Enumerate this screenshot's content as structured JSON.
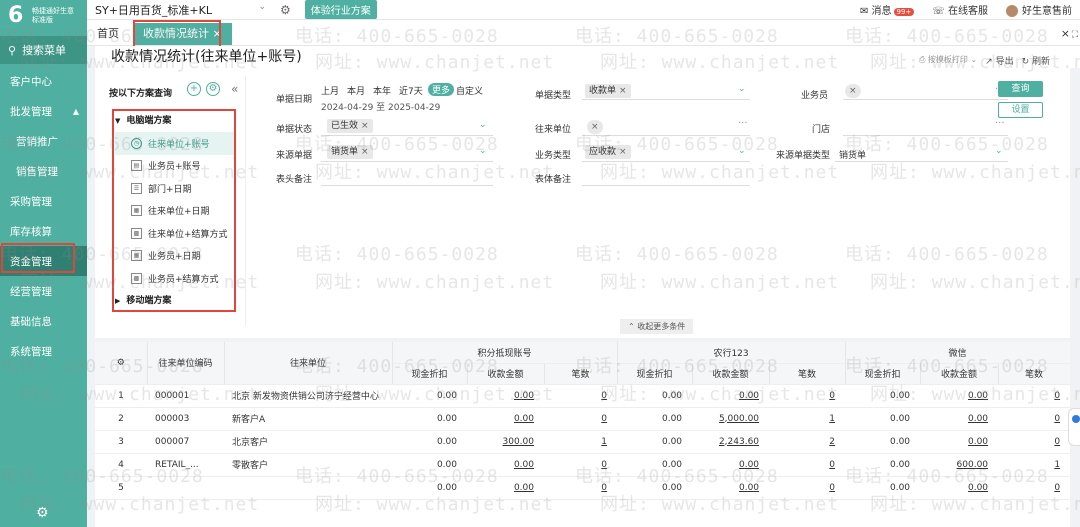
{
  "brand": {
    "logo_mark": "6",
    "logo_text_line1": "畅捷通好生意",
    "logo_text_line2": "标准版"
  },
  "sidebar": {
    "search_label": "搜索菜单",
    "items": [
      {
        "label": "客户中心"
      },
      {
        "label": "批发管理",
        "caret": "▲"
      },
      {
        "label": "营销推广"
      },
      {
        "label": "销售管理"
      },
      {
        "label": "采购管理"
      },
      {
        "label": "库存核算"
      },
      {
        "label": "资金管理"
      },
      {
        "label": "经营管理"
      },
      {
        "label": "基础信息"
      },
      {
        "label": "系统管理"
      }
    ]
  },
  "topbar": {
    "company": "SY+日用百货_标准+KL",
    "industry_button": "体验行业方案",
    "messages": "消息",
    "messages_badge": "99+",
    "support": "在线客服",
    "user": "好生意售前"
  },
  "tabs": {
    "home": "首页",
    "active": "收款情况统计",
    "active_close": "×",
    "close_all": "×"
  },
  "page": {
    "title": "收款情况统计(往来单位+账号)",
    "print": "按模板打印",
    "export": "导出",
    "refresh": "刷新"
  },
  "scheme": {
    "title": "按以下方案查询",
    "pc_group": "电脑端方案",
    "mobile_group": "移动端方案",
    "items": [
      {
        "label": "往来单位+账号",
        "selected": true
      },
      {
        "label": "业务员+账号"
      },
      {
        "label": "部门+日期"
      },
      {
        "label": "往来单位+日期"
      },
      {
        "label": "往来单位+结算方式"
      },
      {
        "label": "业务员+日期"
      },
      {
        "label": "业务员+结算方式"
      }
    ]
  },
  "filters": {
    "doc_date": "单据日期",
    "date_opts": [
      "上月",
      "本月",
      "本年",
      "近7天",
      "更多",
      "自定义"
    ],
    "date_range": "2024-04-29 至 2025-04-29",
    "doc_status": "单据状态",
    "doc_status_tag": "已生效",
    "source_doc": "来源单据",
    "source_doc_tag": "销货单",
    "header_note": "表头备注",
    "doc_type": "单据类型",
    "doc_type_tag": "收款单",
    "partner": "往来单位",
    "biz_type": "业务类型",
    "biz_type_tag": "应收款",
    "body_note": "表体备注",
    "salesman": "业务员",
    "store": "门店",
    "source_doc_type": "来源单据类型",
    "source_doc_type_value": "销货单",
    "query_button": "查询",
    "settings_button": "设置",
    "collapse_more": "收起更多条件"
  },
  "table": {
    "col_partner_code": "往来单位编码",
    "col_partner": "往来单位",
    "groups": [
      "积分抵现账号",
      "农行123",
      "微信"
    ],
    "sub_cols": [
      "现金折扣",
      "收款金额",
      "笔数"
    ],
    "rows": [
      {
        "no": "1",
        "code": "000001",
        "name": "北京 新发物资供销公司济宁经营中心",
        "v": [
          "0.00",
          "0.00",
          "0",
          "0.00",
          "0.00",
          "0",
          "0.00",
          "0.00",
          "0"
        ]
      },
      {
        "no": "2",
        "code": "000003",
        "name": "新客户A",
        "v": [
          "0.00",
          "0.00",
          "0",
          "0.00",
          "5,000.00",
          "1",
          "0.00",
          "0.00",
          "0"
        ]
      },
      {
        "no": "3",
        "code": "000007",
        "name": "北京客户",
        "v": [
          "0.00",
          "300.00",
          "1",
          "0.00",
          "2,243.60",
          "2",
          "0.00",
          "0.00",
          "0"
        ]
      },
      {
        "no": "4",
        "code": "RETAIL_...",
        "name": "零散客户",
        "v": [
          "0.00",
          "0.00",
          "0",
          "0.00",
          "0.00",
          "0",
          "0.00",
          "600.00",
          "1"
        ]
      },
      {
        "no": "5",
        "code": "",
        "name": "",
        "v": [
          "0.00",
          "0.00",
          "0",
          "0.00",
          "0.00",
          "0",
          "0.00",
          "0.00",
          "0"
        ]
      }
    ]
  },
  "watermark": {
    "phone": "电话: 400-665-0028",
    "site": "网址: www.chanjet.net"
  },
  "colors": {
    "primary": "#4fb0a1",
    "highlight_box": "#e0473a"
  }
}
